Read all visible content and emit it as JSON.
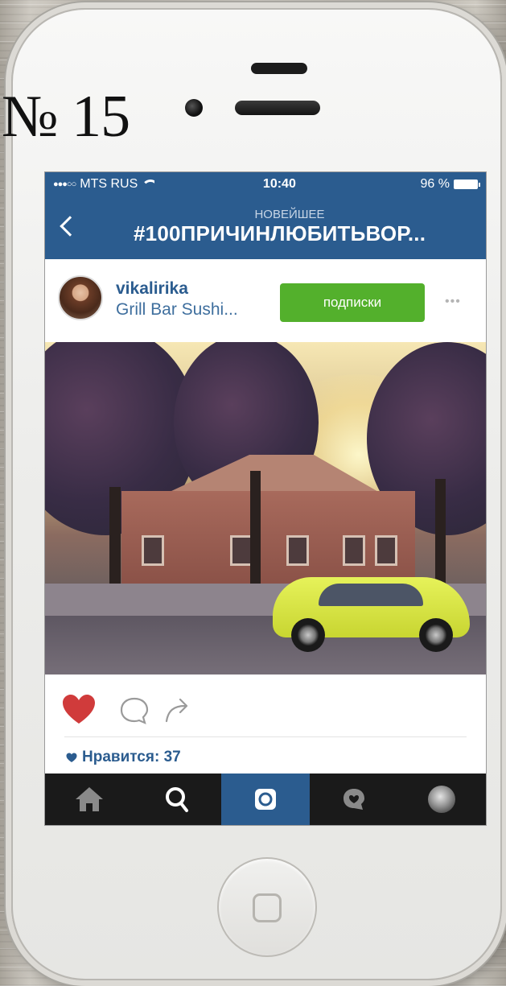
{
  "overlay": {
    "issue_number": "№ 15"
  },
  "status_bar": {
    "signal": "●●●○○",
    "carrier": "MTS RUS",
    "time": "10:40",
    "battery": "96 %"
  },
  "nav": {
    "subtitle": "НОВЕЙШЕЕ",
    "title": "#100ПРИЧИНЛЮБИТЬВОР..."
  },
  "post": {
    "username": "vikalirika",
    "location": "Grill Bar Sushi...",
    "follow_label": "подписки",
    "more_label": "•••",
    "liked": true,
    "likes_text": "Нравится: 37"
  },
  "tab_bar": {
    "items": [
      {
        "name": "home",
        "icon": "home-icon"
      },
      {
        "name": "search",
        "icon": "search-icon"
      },
      {
        "name": "camera",
        "icon": "camera-icon",
        "active": true
      },
      {
        "name": "activity",
        "icon": "activity-icon"
      },
      {
        "name": "profile",
        "icon": "profile-avatar"
      }
    ]
  },
  "colors": {
    "accent": "#2b5c8f",
    "follow_green": "#53b02c",
    "like_red": "#d03b3b"
  }
}
